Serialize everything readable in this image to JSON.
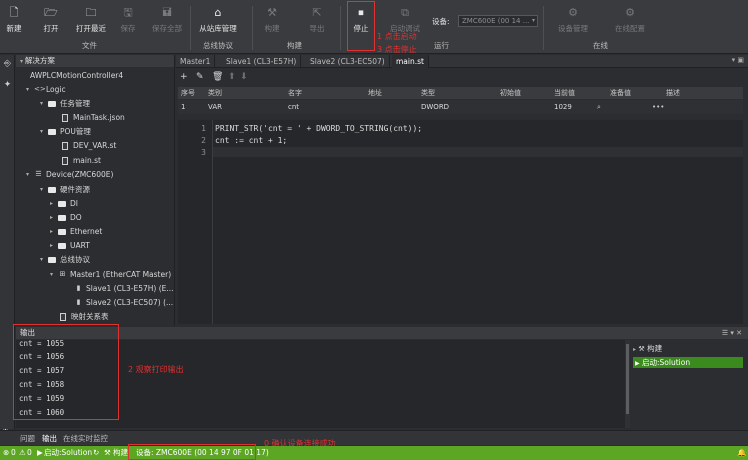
{
  "ribbon": {
    "new": "新建",
    "open": "打开",
    "open_recent": "打开最近",
    "save": "保存",
    "save_all": "保存全部",
    "file_group": "文件",
    "from_station": "从站库管理",
    "bus_group": "总线协议",
    "build": "构建",
    "export": "导出",
    "build_group": "构建",
    "stop": "停止",
    "start_debug": "启动调试",
    "run_group": "运行",
    "device_label": "设备:",
    "device_value": "ZMC600E (00 14 ...",
    "device_manage": "设备管理",
    "online_config": "在线配置",
    "online_group": "在线"
  },
  "annotations": {
    "step1": "1 点击启动",
    "step3": "3 点击停止",
    "step2": "2 观察打印输出",
    "step0": "0 确认设备连接成功"
  },
  "tree": {
    "title": "解决方案",
    "nodes": [
      "AWPLCMotionController4",
      "Logic",
      "任务管理",
      "MainTask.json",
      "POU管理",
      "DEV_VAR.st",
      "main.st",
      "Device(ZMC600E)",
      "硬件资源",
      "DI",
      "DO",
      "Ethernet",
      "UART",
      "总线协议",
      "Master1 (EtherCAT Master)",
      "Slave1 (CL3-E57H) (E...",
      "Slave2 (CL3-EC507) (...",
      "映射关系表"
    ]
  },
  "tabs": [
    "Master1",
    "Slave1 (CL3-E57H)",
    "Slave2 (CL3-EC507)",
    "main.st"
  ],
  "vartable": {
    "headers": [
      "序号",
      "类别",
      "名字",
      "地址",
      "类型",
      "初始值",
      "当前值",
      "准备值",
      "描述"
    ],
    "row": [
      "1",
      "VAR",
      "cnt",
      "",
      "DWORD",
      "",
      "1029",
      "",
      ""
    ]
  },
  "code": {
    "line_numbers": [
      "1",
      "2",
      "3"
    ],
    "line1": "PRINT_STR('cnt = ' + DWORD_TO_STRING(cnt));",
    "line2": "cnt := cnt + 1;",
    "line3": ""
  },
  "output": {
    "title": "输出",
    "lines": [
      "cnt = 1055",
      "cnt = 1056",
      "cnt = 1057",
      "cnt = 1058",
      "cnt = 1059",
      "cnt = 1060"
    ],
    "build_node": "构建",
    "run_node": "启动:Solution"
  },
  "bottom_tabs": [
    "问题",
    "输出",
    "在线实时监控"
  ],
  "status": {
    "errors": "0",
    "warnings": "0",
    "run": "启动:Solution",
    "build": "构建",
    "device": "设备: ZMC600E (00 14 97 0F 01 17)"
  }
}
